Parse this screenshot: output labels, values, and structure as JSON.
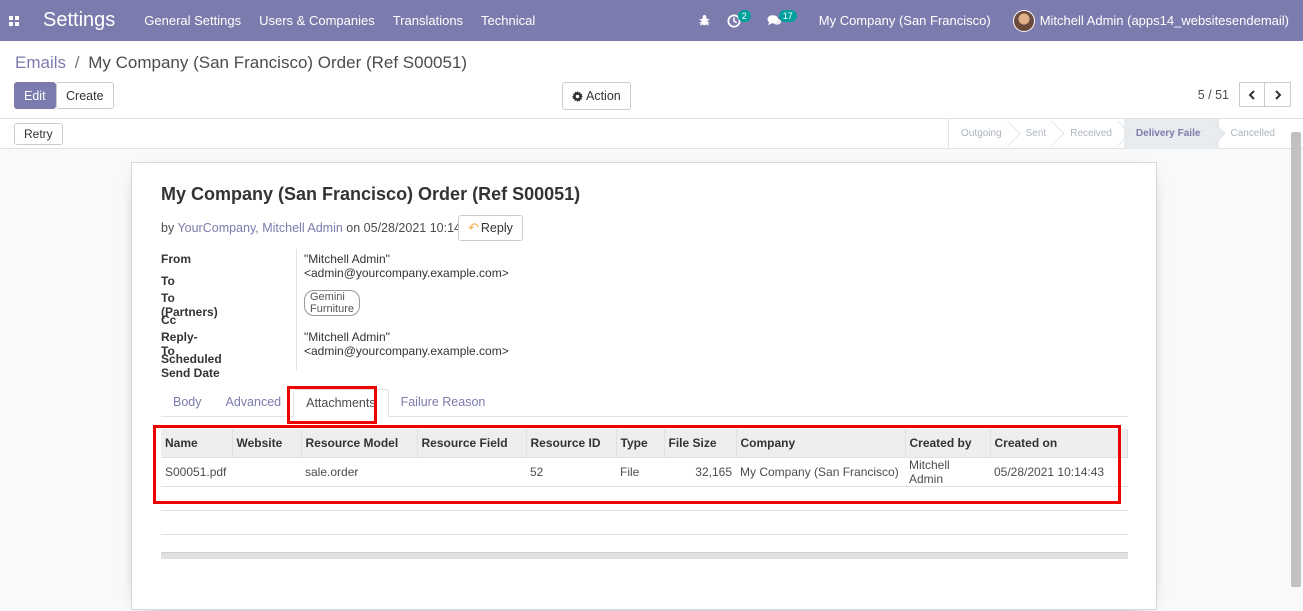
{
  "navbar": {
    "brand": "Settings",
    "menu": [
      "General Settings",
      "Users & Companies",
      "Translations",
      "Technical"
    ],
    "activity_count": "2",
    "message_count": "17",
    "company": "My Company (San Francisco)",
    "user": "Mitchell Admin (apps14_websitesendemail)"
  },
  "breadcrumb": {
    "parent": "Emails",
    "separator": "/",
    "current": "My Company (San Francisco) Order (Ref S00051)"
  },
  "buttons": {
    "edit": "Edit",
    "create": "Create",
    "action": "Action",
    "retry": "Retry",
    "reply": "Reply"
  },
  "pager": {
    "value": "5 / 51"
  },
  "statusbar": {
    "stages": [
      "Outgoing",
      "Sent",
      "Received",
      "Delivery Failed",
      "Cancelled"
    ],
    "active": "Delivery Failed"
  },
  "email": {
    "subject": "My Company (San Francisco) Order (Ref S00051)",
    "by_prefix": "by",
    "authors": "YourCompany, Mitchell Admin",
    "date_prefix": "on 05/28/2021 10:14:50",
    "fields": {
      "from_label": "From",
      "from_value": "\"Mitchell Admin\" <admin@yourcompany.example.com>",
      "to_label": "To",
      "to_partners_label": "To (Partners)",
      "to_partners_tag": "Gemini Furniture",
      "cc_label": "Cc",
      "reply_to_label": "Reply-To",
      "reply_to_value": "\"Mitchell Admin\" <admin@yourcompany.example.com>",
      "scheduled_label": "Scheduled Send Date"
    }
  },
  "tabs": [
    "Body",
    "Advanced",
    "Attachments",
    "Failure Reason"
  ],
  "attachments": {
    "columns": [
      "Name",
      "Website",
      "Resource Model",
      "Resource Field",
      "Resource ID",
      "Type",
      "File Size",
      "Company",
      "Created by",
      "Created on"
    ],
    "row": {
      "name": "S00051.pdf",
      "website": "",
      "resource_model": "sale.order",
      "resource_field": "",
      "resource_id": "52",
      "type": "File",
      "file_size": "32,165",
      "company": "My Company (San Francisco)",
      "created_by": "Mitchell Admin",
      "created_on": "05/28/2021 10:14:43"
    }
  },
  "colors": {
    "brand": "#7c7bad",
    "badge": "#00a09d",
    "highlight": "#ee0000"
  }
}
